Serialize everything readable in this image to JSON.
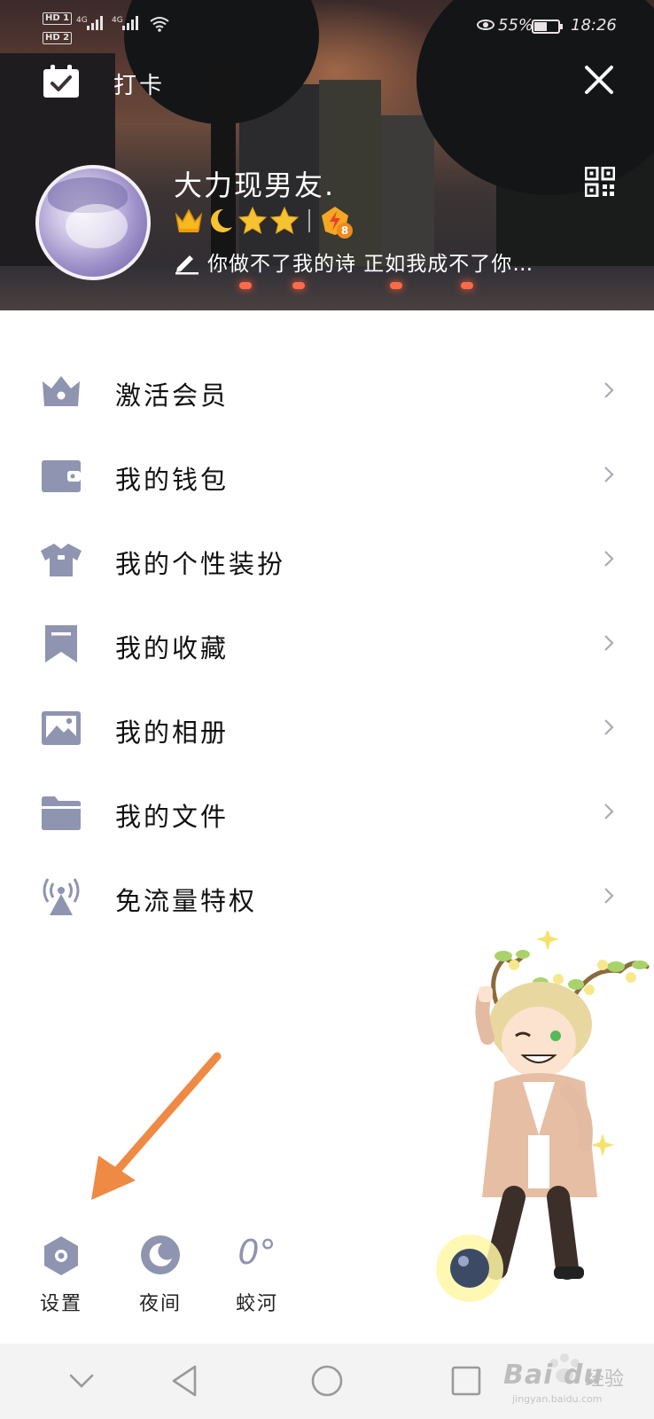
{
  "status_bar": {
    "hd1": "HD 1",
    "hd2": "HD 2",
    "net1": "4G",
    "net2": "4G",
    "battery_text": "55%",
    "battery_level": 0.55,
    "time": "18:26"
  },
  "header": {
    "checkin_label": "打卡",
    "username": "大力现男友.",
    "vip_level": "8",
    "signature": "你做不了我的诗 正如我成不了你…"
  },
  "badges": [
    "crown-icon",
    "moon-icon",
    "star-icon",
    "star-icon"
  ],
  "menu": [
    {
      "label": "激活会员",
      "icon": "vip-crown-icon"
    },
    {
      "label": "我的钱包",
      "icon": "wallet-icon"
    },
    {
      "label": "我的个性装扮",
      "icon": "tshirt-icon"
    },
    {
      "label": "我的收藏",
      "icon": "bookmark-icon"
    },
    {
      "label": "我的相册",
      "icon": "photo-icon"
    },
    {
      "label": "我的文件",
      "icon": "folder-icon"
    },
    {
      "label": "免流量特权",
      "icon": "signal-tower-icon"
    }
  ],
  "actions": {
    "settings": "设置",
    "night": "夜间",
    "weather_temp": "0°",
    "weather_city": "蛟河"
  },
  "watermark": {
    "brand": "Bai du",
    "cn": "经验",
    "url": "jingyan.baidu.com"
  },
  "colors": {
    "icon": "#8f94b0",
    "arrow": "#ef8a45",
    "text": "#111111"
  }
}
